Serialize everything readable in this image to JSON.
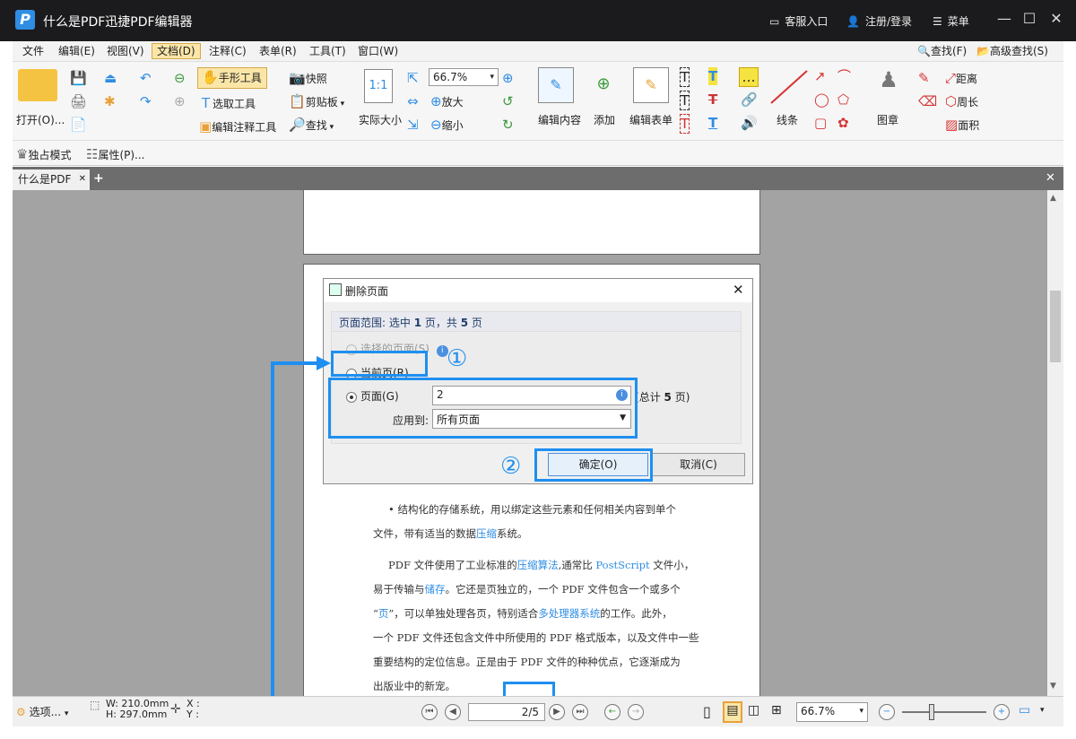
{
  "window": {
    "title": "什么是PDF迅捷PDF编辑器",
    "logo": "P",
    "customer_service": "客服入口",
    "register": "注册/登录",
    "menu": "菜单"
  },
  "menubar": [
    "文件",
    "编辑(E)",
    "视图(V)",
    "文档(D)",
    "注释(C)",
    "表单(R)",
    "工具(T)",
    "窗口(W)"
  ],
  "menubar_right": {
    "find": "查找(F)",
    "adv_find": "高级查找(S)"
  },
  "ribbon": {
    "open": "打开(O)...",
    "hand_tool": "手形工具",
    "select_tool": "选取工具",
    "edit_annot_tool": "编辑注释工具",
    "snapshot": "快照",
    "clipboard": "剪贴板",
    "find": "查找",
    "actual_size": "实际大小",
    "zoom_value": "66.7%",
    "zoom_in": "放大",
    "zoom_out": "缩小",
    "edit_content": "编辑内容",
    "add": "添加",
    "edit_form": "编辑表单",
    "lines": "线条",
    "stamp": "图章",
    "distance": "距离",
    "perimeter": "周长",
    "area": "面积"
  },
  "subbar": {
    "exclusive_mode": "独占模式",
    "properties": "属性(P)..."
  },
  "tab": {
    "label": "什么是PDF"
  },
  "dialog": {
    "title": "删除页面",
    "range_text_1": "页面范围: 选中",
    "range_sel": "1",
    "range_text_2": "页，共",
    "range_total": "5",
    "range_text_3": "页",
    "opt_selected": "选择的页面(S)",
    "opt_current": "当前页(R)",
    "opt_pages": "页面(G)",
    "pages_value": "2",
    "total_text_1": "总计",
    "total_num": "5",
    "total_text_2": "页",
    "apply_to_label": "应用到:",
    "apply_to_value": "所有页面",
    "ok": "确定(O)",
    "cancel": "取消(C)"
  },
  "annotations": {
    "marker1": "①",
    "marker2": "②"
  },
  "doc_lines": [
    {
      "parts": [
        {
          "t": "• 结构化的存储系统，用以绑定这些元素和任何相关内容到单个"
        }
      ]
    },
    {
      "parts": [
        {
          "t": "文件，带有适当的数据"
        },
        {
          "t": "压缩",
          "link": true
        },
        {
          "t": "系统。"
        }
      ]
    },
    {
      "parts": [
        {
          "t": "PDF 文件使用了工业标准的"
        },
        {
          "t": "压缩算法",
          "link": true
        },
        {
          "t": ",通常比 "
        },
        {
          "t": "PostScript",
          "link": true
        },
        {
          "t": " 文件小，"
        }
      ]
    },
    {
      "parts": [
        {
          "t": "易于传输与"
        },
        {
          "t": "储存",
          "link": true
        },
        {
          "t": "。它还是页独立的，一个 PDF 文件包含一个或多个"
        }
      ]
    },
    {
      "parts": [
        {
          "t": "“"
        },
        {
          "t": "页",
          "link": true
        },
        {
          "t": "”，可以单独处理各页，特别适合"
        },
        {
          "t": "多处理器系统",
          "link": true
        },
        {
          "t": "的工作。此外，"
        }
      ]
    },
    {
      "parts": [
        {
          "t": "一个 PDF 文件还包含文件中所使用的 PDF 格式版本，以及文件中一些"
        }
      ]
    },
    {
      "parts": [
        {
          "t": "重要结构的定位信息。正是由于 PDF 文件的种种优点，它逐渐成为"
        }
      ]
    },
    {
      "parts": [
        {
          "t": "出版业中的新宠。"
        }
      ]
    }
  ],
  "statusbar": {
    "options": "选项...",
    "width": "W: 210.0mm",
    "height": "H: 297.0mm",
    "x_label": "X :",
    "y_label": "Y :",
    "page_value": "2/5",
    "zoom_value": "66.7%"
  }
}
